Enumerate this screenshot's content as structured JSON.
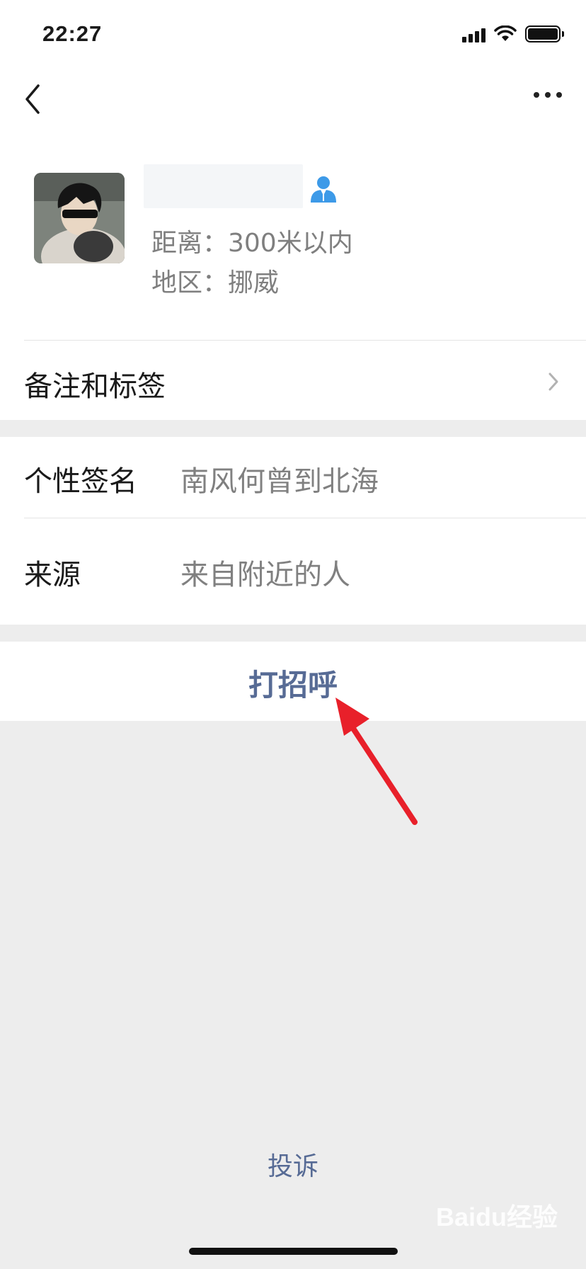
{
  "status_bar": {
    "time": "22:27"
  },
  "profile": {
    "distance": "距离：300米以内",
    "region": "地区：挪威"
  },
  "rows": {
    "tags_label": "备注和标签",
    "signature_label": "个性签名",
    "signature_value": "南风何曾到北海",
    "source_label": "来源",
    "source_value": "来自附近的人"
  },
  "actions": {
    "greet": "打招呼",
    "complain": "投诉"
  },
  "watermark": {
    "text": "Baidu经验"
  },
  "colors": {
    "link": "#576b95",
    "background": "#ededed",
    "annotation_arrow": "#e8202a",
    "contact_icon": "#3d9ae8"
  }
}
